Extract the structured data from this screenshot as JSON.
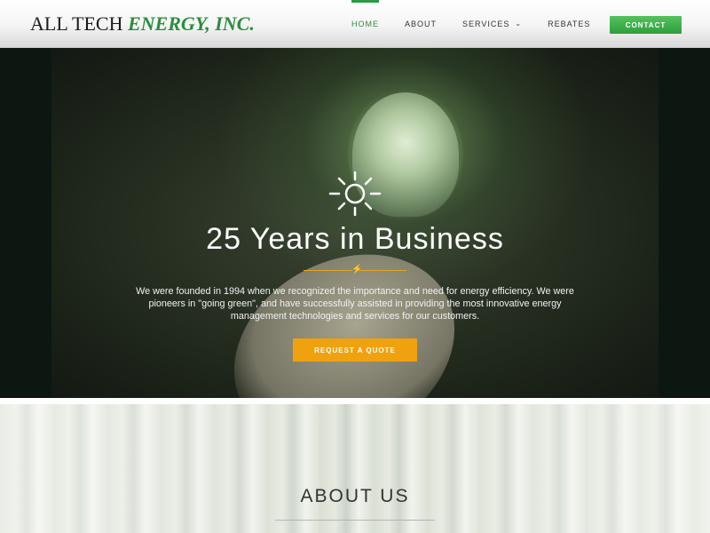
{
  "logo": {
    "part_a": "ALL TECH ",
    "part_b": "ENERGY, INC."
  },
  "nav": {
    "home": "HOME",
    "about": "ABOUT",
    "services": "SERVICES",
    "rebates": "REBATES",
    "contact": "CONTACT"
  },
  "hero": {
    "title": "25 Years in Business",
    "text": "We were founded in 1994 when we recognized the importance and need for energy efficiency. We were pioneers in \"going green\", and have successfully assisted in providing the most innovative energy management technologies and services for our customers.",
    "cta": "REQUEST A QUOTE"
  },
  "about": {
    "title": "ABOUT US"
  },
  "colors": {
    "brand_green": "#2c8d3e",
    "accent_orange": "#f0a10e",
    "contact_green": "#3fb04b"
  },
  "icons": {
    "dropdown": "chevron-down-icon",
    "hero_sun": "sun-icon",
    "divider": "lightning-bolt-icon"
  }
}
